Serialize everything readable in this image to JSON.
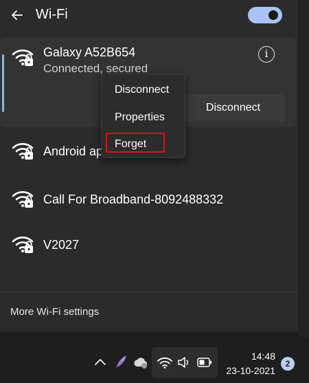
{
  "header": {
    "title": "Wi-Fi",
    "back_icon": "back-arrow-icon",
    "toggle_state": "on"
  },
  "connected_network": {
    "name": "Galaxy A52B654",
    "status": "Connected, secured",
    "info_symbol": "i",
    "disconnect_label": "Disconnect",
    "icon": "wifi-secured-icon"
  },
  "context_menu": {
    "items": [
      {
        "label": "Disconnect"
      },
      {
        "label": "Properties"
      },
      {
        "label": "Forget"
      }
    ],
    "highlight_color": "#d7141a"
  },
  "networks": [
    {
      "name": "Android ap",
      "icon": "wifi-secured-icon"
    },
    {
      "name": "Call For Broadband-8092488332",
      "icon": "wifi-secured-icon"
    },
    {
      "name": "V2027",
      "icon": "wifi-secured-icon"
    }
  ],
  "footer": {
    "more_settings": "More Wi-Fi settings"
  },
  "taskbar": {
    "time": "14:48",
    "date": "23-10-2021",
    "notification_count": "2",
    "icons": [
      "chevron-up-icon",
      "feather-icon",
      "cloud-icon",
      "wifi-icon",
      "volume-icon",
      "battery-icon"
    ]
  },
  "colors": {
    "accent": "#8fb3e8",
    "toggle": "#a8c4f5",
    "panel": "#2b2b2b"
  }
}
